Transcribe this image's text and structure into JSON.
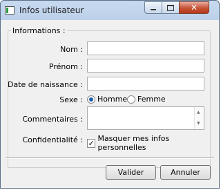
{
  "window": {
    "title": "Infos utilisateur",
    "icon": "app-window-icon",
    "controls": {
      "minimize": "minimize-icon",
      "maximize": "maximize-icon",
      "close": "close-icon"
    }
  },
  "group": {
    "title": "Informations :",
    "fields": {
      "nom": {
        "label": "Nom :",
        "value": ""
      },
      "prenom": {
        "label": "Prénom :",
        "value": ""
      },
      "date_naissance": {
        "label": "Date de naissance :",
        "value": ""
      },
      "sexe": {
        "label": "Sexe :",
        "options": [
          "Homme",
          "Femme"
        ],
        "selected": "Homme"
      },
      "commentaires": {
        "label": "Commentaires :",
        "value": ""
      },
      "confidentialite": {
        "label": "Confidentialité :",
        "checkbox_label": "Masquer mes infos personnelles",
        "checked": true
      }
    }
  },
  "buttons": {
    "ok": "Valider",
    "cancel": "Annuler"
  },
  "colors": {
    "accent": "#1c5fa8",
    "title_bar": "#bcd1ea",
    "close_button": "#c45234"
  }
}
